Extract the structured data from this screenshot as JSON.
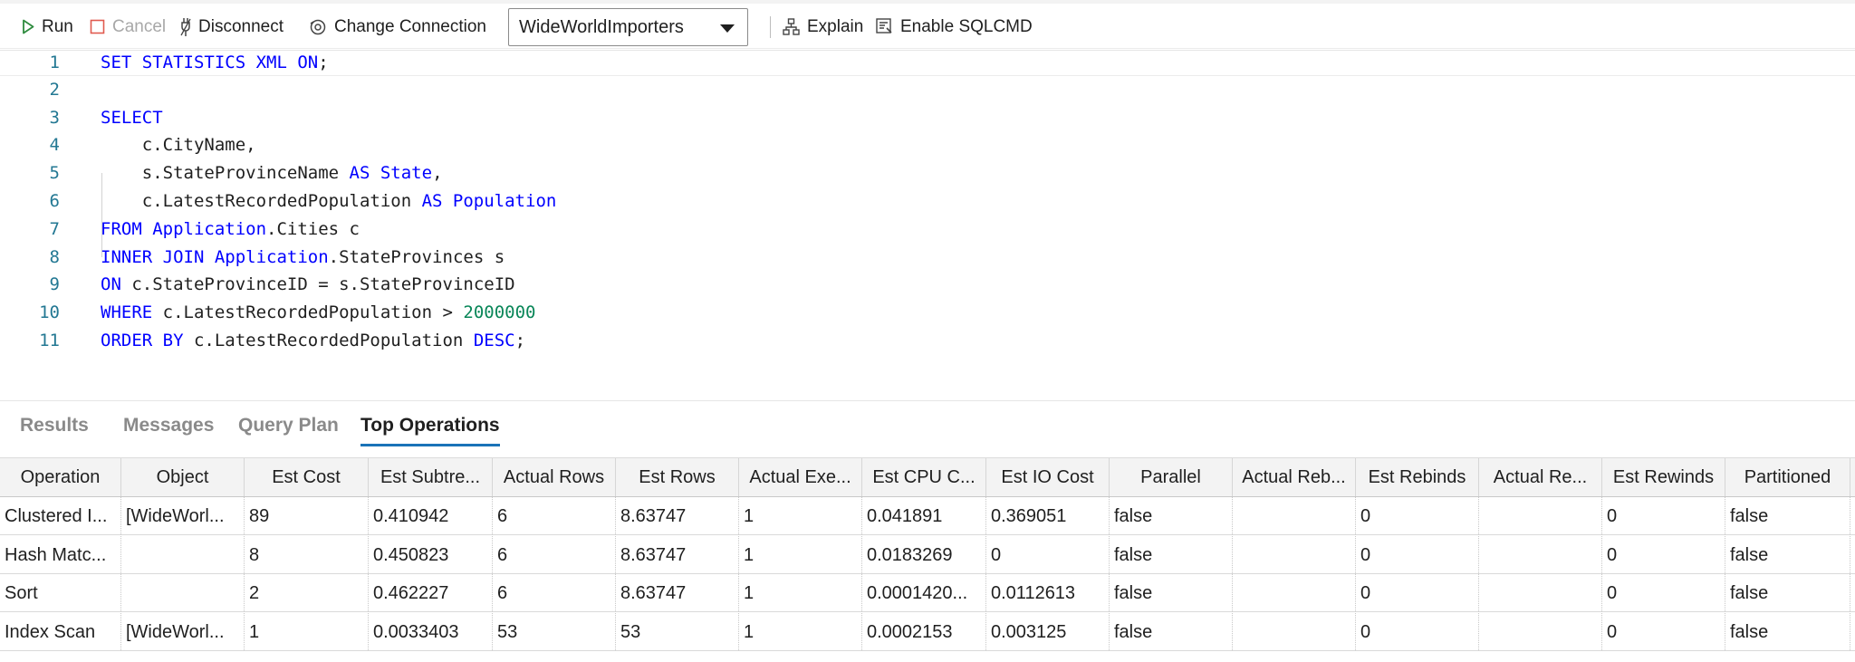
{
  "toolbar": {
    "run": "Run",
    "cancel": "Cancel",
    "disconnect": "Disconnect",
    "change_connection": "Change Connection",
    "database": "WideWorldImporters",
    "explain": "Explain",
    "enable_sqlcmd": "Enable SQLCMD"
  },
  "editor": {
    "line_numbers": [
      "1",
      "2",
      "3",
      "4",
      "5",
      "6",
      "7",
      "8",
      "9",
      "10",
      "11"
    ],
    "lines": [
      [
        {
          "t": "SET STATISTICS XML ON",
          "c": "kw"
        },
        {
          "t": ";",
          "c": ""
        }
      ],
      [],
      [
        {
          "t": "SELECT",
          "c": "kw"
        }
      ],
      [
        {
          "t": "    c.CityName,",
          "c": ""
        }
      ],
      [
        {
          "t": "    s.StateProvinceName ",
          "c": ""
        },
        {
          "t": "AS State",
          "c": "kw"
        },
        {
          "t": ",",
          "c": ""
        }
      ],
      [
        {
          "t": "    c.LatestRecordedPopulation ",
          "c": ""
        },
        {
          "t": "AS Population",
          "c": "kw"
        }
      ],
      [
        {
          "t": "FROM Application",
          "c": "kw"
        },
        {
          "t": ".Cities c",
          "c": ""
        }
      ],
      [
        {
          "t": "INNER JOIN Application",
          "c": "kw"
        },
        {
          "t": ".StateProvinces s",
          "c": ""
        }
      ],
      [
        {
          "t": "ON",
          "c": "kw"
        },
        {
          "t": " c.StateProvinceID = s.StateProvinceID",
          "c": ""
        }
      ],
      [
        {
          "t": "WHERE",
          "c": "kw"
        },
        {
          "t": " c.LatestRecordedPopulation > ",
          "c": ""
        },
        {
          "t": "2000000",
          "c": "num"
        }
      ],
      [
        {
          "t": "ORDER BY",
          "c": "kw"
        },
        {
          "t": " c.LatestRecordedPopulation ",
          "c": ""
        },
        {
          "t": "DESC",
          "c": "kw"
        },
        {
          "t": ";",
          "c": ""
        }
      ]
    ]
  },
  "tabs": [
    "Results",
    "Messages",
    "Query Plan",
    "Top Operations"
  ],
  "active_tab": "Top Operations",
  "grid": {
    "columns": [
      "Operation",
      "Object",
      "Est Cost",
      "Est Subtre...",
      "Actual Rows",
      "Est Rows",
      "Actual Exe...",
      "Est CPU C...",
      "Est IO Cost",
      "Parallel",
      "Actual Reb...",
      "Est Rebinds",
      "Actual Re...",
      "Est Rewinds",
      "Partitioned"
    ],
    "rows": [
      [
        "Clustered I...",
        "[WideWorl...",
        "89",
        "0.410942",
        "6",
        "8.63747",
        "1",
        "0.041891",
        "0.369051",
        "false",
        "",
        "0",
        "",
        "0",
        "false"
      ],
      [
        "Hash Matc...",
        "",
        "8",
        "0.450823",
        "6",
        "8.63747",
        "1",
        "0.0183269",
        "0",
        "false",
        "",
        "0",
        "",
        "0",
        "false"
      ],
      [
        "Sort",
        "",
        "2",
        "0.462227",
        "6",
        "8.63747",
        "1",
        "0.0001420...",
        "0.0112613",
        "false",
        "",
        "0",
        "",
        "0",
        "false"
      ],
      [
        "Index Scan",
        "[WideWorl...",
        "1",
        "0.0033403",
        "53",
        "53",
        "1",
        "0.0002153",
        "0.003125",
        "false",
        "",
        "0",
        "",
        "0",
        "false"
      ]
    ]
  }
}
